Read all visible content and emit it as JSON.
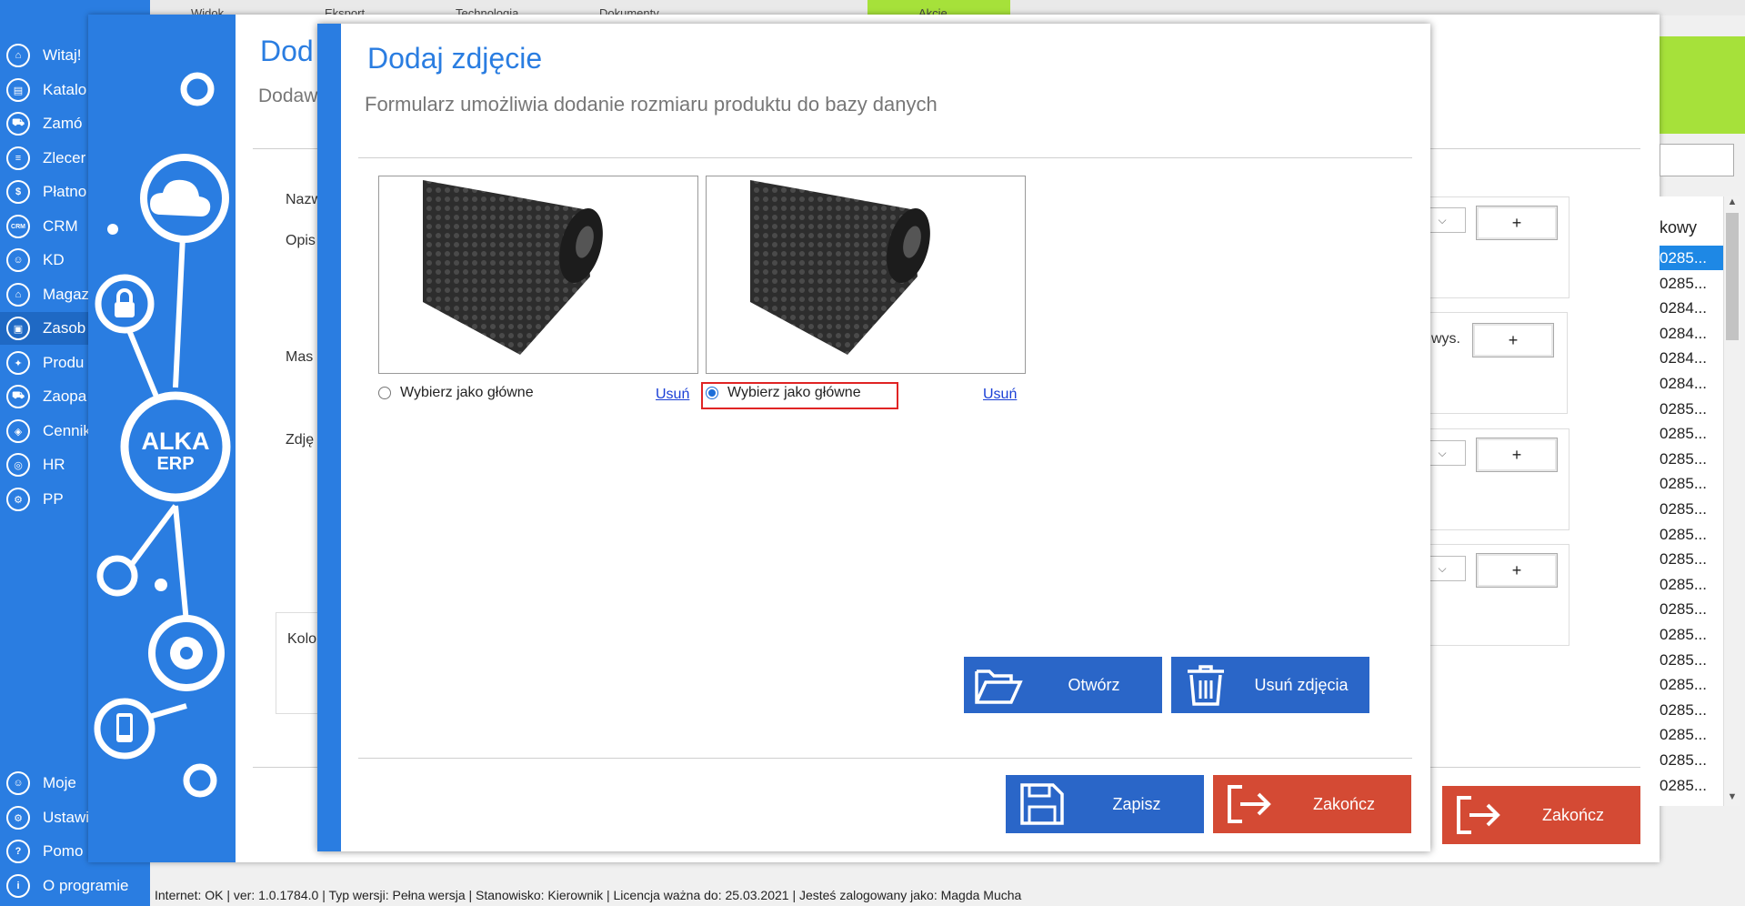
{
  "sidebar": {
    "items": [
      {
        "label": "Witaj!",
        "icon": "home-icon"
      },
      {
        "label": "Katalo",
        "icon": "book-icon"
      },
      {
        "label": "Zamó",
        "icon": "cart-icon"
      },
      {
        "label": "Zlecer",
        "icon": "list-icon"
      },
      {
        "label": "Płatno",
        "icon": "dollar-icon"
      },
      {
        "label": "CRM",
        "icon": "crm-icon"
      },
      {
        "label": "KD",
        "icon": "person-icon"
      },
      {
        "label": "Magaz",
        "icon": "warehouse-icon"
      },
      {
        "label": "Zasob",
        "icon": "resources-icon"
      },
      {
        "label": "Produ",
        "icon": "production-icon"
      },
      {
        "label": "Zaopa",
        "icon": "truck-icon"
      },
      {
        "label": "Cennik",
        "icon": "tag-icon"
      },
      {
        "label": "HR",
        "icon": "hr-icon"
      },
      {
        "label": "PP",
        "icon": "factory-icon"
      }
    ],
    "bottom_items": [
      {
        "label": "Moje",
        "icon": "user-icon"
      },
      {
        "label": "Ustawi",
        "icon": "settings-icon"
      },
      {
        "label": "Pomo",
        "icon": "help-icon"
      },
      {
        "label": "O programie",
        "icon": "info-icon"
      }
    ]
  },
  "topbar": {
    "tabs": [
      "Widok",
      "Eksport",
      "Technologia",
      "Dokumenty",
      "Akcje"
    ]
  },
  "graphic": {
    "logo_line1": "ALKA",
    "logo_line2": "ERP"
  },
  "background_form": {
    "title": "Dod",
    "subtitle": "Dodaw",
    "labels": {
      "name": "Nazw",
      "desc": "Opis",
      "mass": "Mas",
      "photo": "Zdję",
      "color": "Kolo"
    },
    "extra_label": "wys.",
    "plus": "+",
    "list_header": "kowy",
    "list_rows": [
      "0285...",
      "0285...",
      "0284...",
      "0284...",
      "0284...",
      "0284...",
      "0285...",
      "0285...",
      "0285...",
      "0285...",
      "0285...",
      "0285...",
      "0285...",
      "0285...",
      "0285...",
      "0285...",
      "0285...",
      "0285...",
      "0285...",
      "0285...",
      "0285...",
      "0285..."
    ],
    "close_button": "Zakończ"
  },
  "dialog": {
    "title": "Dodaj zdjęcie",
    "subtitle": "Formularz umożliwia dodanie rozmiaru produktu do bazy danych",
    "photos": [
      {
        "radio_label": "Wybierz jako główne",
        "remove_label": "Usuń",
        "selected": false
      },
      {
        "radio_label": "Wybierz jako główne",
        "remove_label": "Usuń",
        "selected": true
      }
    ],
    "open_button": "Otwórz",
    "delete_photos_button": "Usuń zdjęcia",
    "save_button": "Zapisz",
    "close_button": "Zakończ"
  },
  "status_bar": "Internet: OK  |   ver: 1.0.1784.0   |   Typ wersji: Pełna wersja   |   Stanowisko: Kierownik   |   Licencja ważna do: 25.03.2021   |   Jesteś zalogowany jako: Magda Mucha",
  "colors": {
    "accent": "#2a7de1",
    "green": "#a6e13a",
    "save_blue": "#2a66c8",
    "close_red": "#d44a34",
    "highlight": "#e02424"
  }
}
